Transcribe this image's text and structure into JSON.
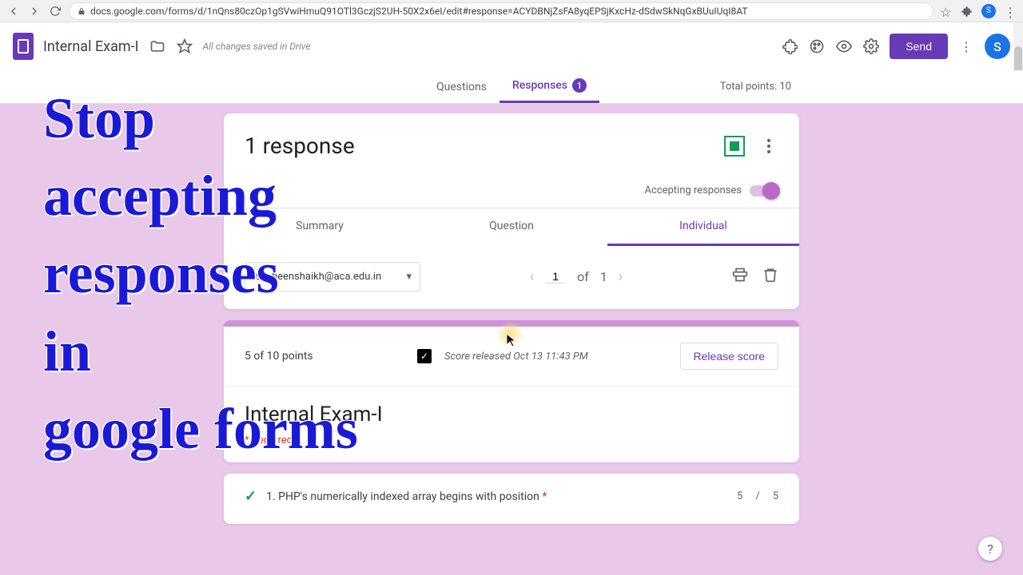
{
  "browser": {
    "url": "docs.google.com/forms/d/1nQns80czOp1gSVwiHmuQ91OTl3GczjS2UH-50X2x6eI/edit#response=ACYDBNjZsFA8yqEPSjKxcHz-dSdwSkNqGxBUuIUqI8AT",
    "avatar_initial": "S"
  },
  "header": {
    "doc_title": "Internal Exam-I",
    "save_msg": "All changes saved in Drive",
    "send_label": "Send",
    "avatar_initial": "S"
  },
  "tabs": {
    "questions": "Questions",
    "responses": "Responses",
    "badge": "1",
    "total_points": "Total points: 10"
  },
  "responses_card": {
    "title": "1 response",
    "accepting_label": "Accepting responses",
    "subtabs": {
      "summary": "Summary",
      "question": "Question",
      "individual": "Individual"
    },
    "email": "shaheenshaikh@aca.edu.in",
    "pager": {
      "current": "1",
      "of": "of",
      "total": "1"
    }
  },
  "score": {
    "points": "5 of 10 points",
    "released": "Score released Oct 13 11:43 PM",
    "release_btn": "Release score",
    "form_title": "Internal Exam-I",
    "required": "Required"
  },
  "question1": {
    "text": "1. PHP's numerically indexed array begins with position ",
    "score_got": "5",
    "score_max": "5"
  },
  "overlay": "Stop\naccepting\nresponses\nin\ngoogle forms"
}
